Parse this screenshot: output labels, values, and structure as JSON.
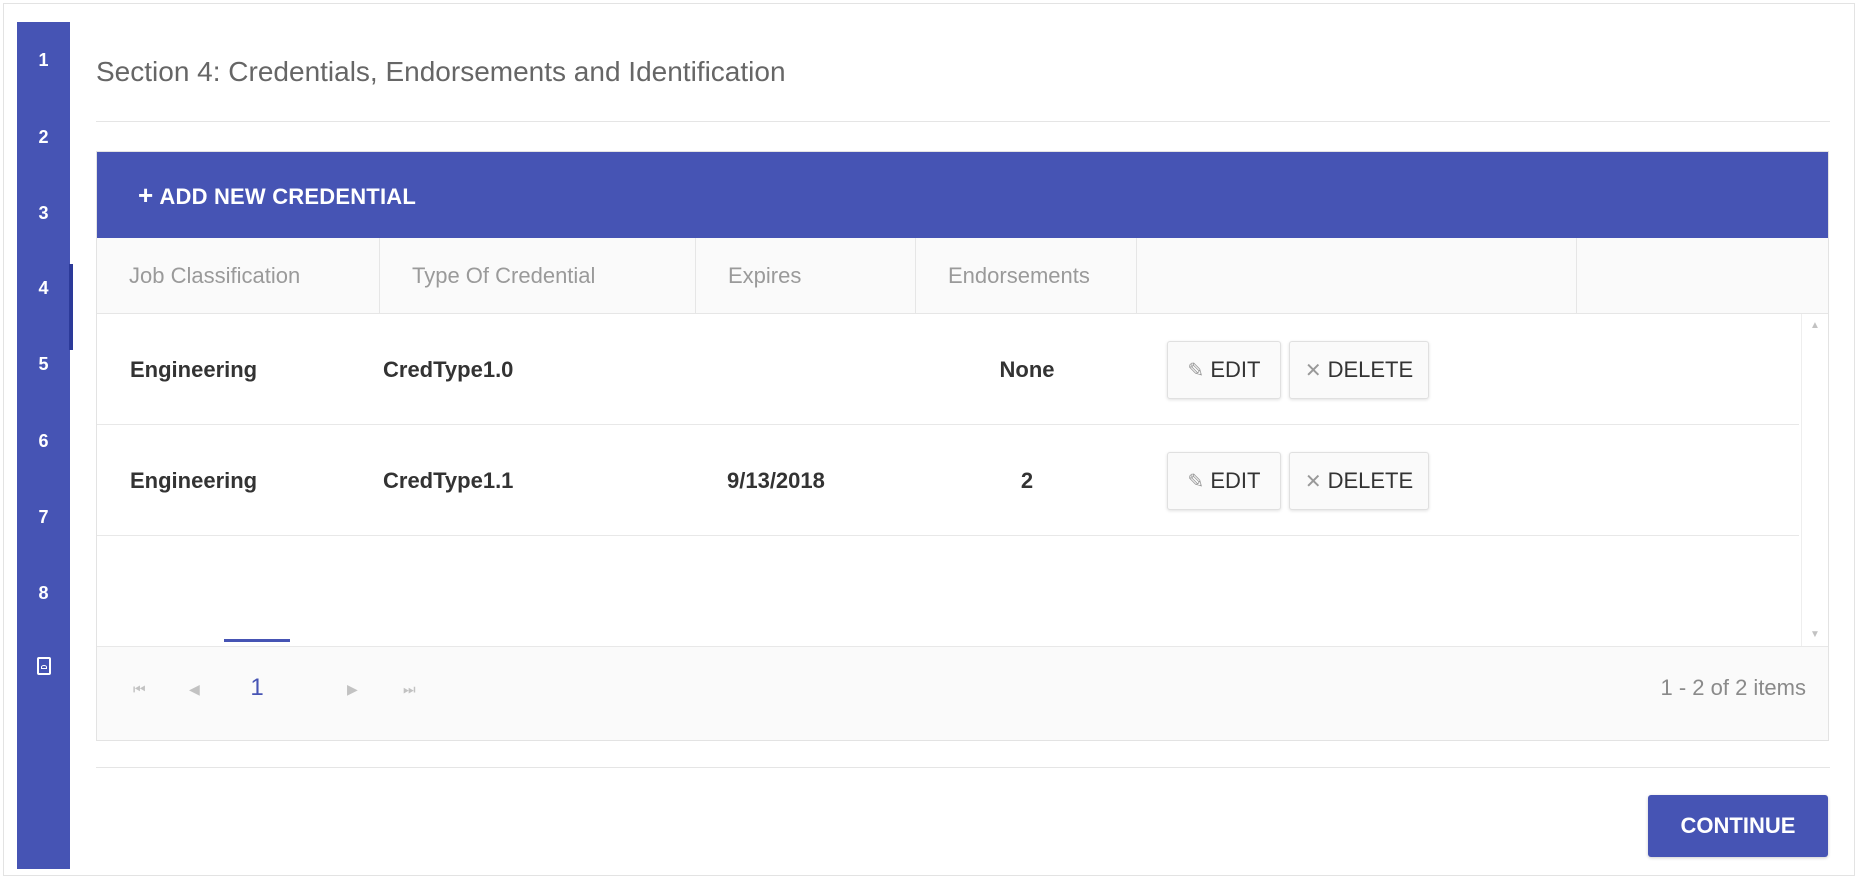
{
  "steps": [
    "1",
    "2",
    "3",
    "4",
    "5",
    "6",
    "7",
    "8"
  ],
  "active_step": "4",
  "section_title": "Section 4: Credentials, Endorsements and Identification",
  "toolbar": {
    "add_icon": "plus-icon",
    "add_label": "ADD NEW CREDENTIAL"
  },
  "columns": [
    "Job Classification",
    "Type Of Credential",
    "Expires",
    "Endorsements"
  ],
  "rows": [
    {
      "job_classification": "Engineering",
      "type_of_credential": "CredType1.0",
      "expires": "",
      "endorsements": "None"
    },
    {
      "job_classification": "Engineering",
      "type_of_credential": "CredType1.1",
      "expires": "9/13/2018",
      "endorsements": "2"
    }
  ],
  "row_actions": {
    "edit_label": "EDIT",
    "delete_label": "DELETE",
    "edit_icon": "pencil-icon",
    "delete_icon": "x-icon"
  },
  "pager": {
    "current_page": "1",
    "info": "1 - 2 of 2 items"
  },
  "continue_label": "CONTINUE",
  "colors": {
    "accent": "#4654b4"
  }
}
